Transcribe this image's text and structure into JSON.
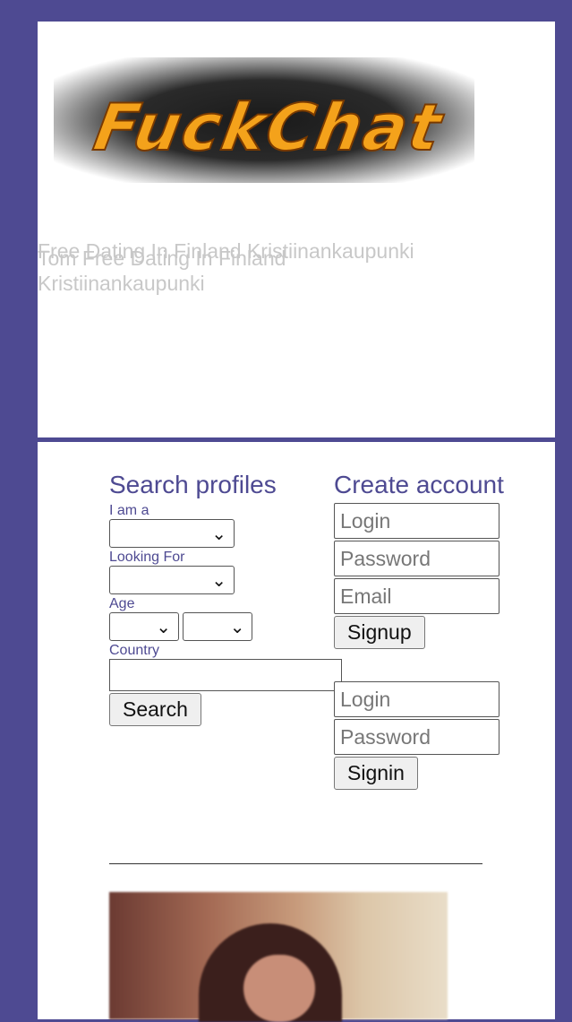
{
  "logo": {
    "text": "FuckChat"
  },
  "page_title": {
    "line_a": "Free Dating In Finland Kristiinankaupunki",
    "line_b": "Tom Free Dating In Finland Kristiinankaupunki"
  },
  "search": {
    "heading": "Search profiles",
    "i_am_label": "I am a",
    "looking_for_label": "Looking For",
    "age_label": "Age",
    "country_label": "Country",
    "search_button": "Search"
  },
  "create_account": {
    "heading": "Create account",
    "login_placeholder": "Login",
    "password_placeholder": "Password",
    "email_placeholder": "Email",
    "signup_button": "Signup"
  },
  "signin": {
    "login_placeholder": "Login",
    "password_placeholder": "Password",
    "signin_button": "Signin"
  },
  "colors": {
    "frame": "#4e4a92",
    "accent_text": "#4e4a92",
    "logo": "#f4a21b"
  }
}
